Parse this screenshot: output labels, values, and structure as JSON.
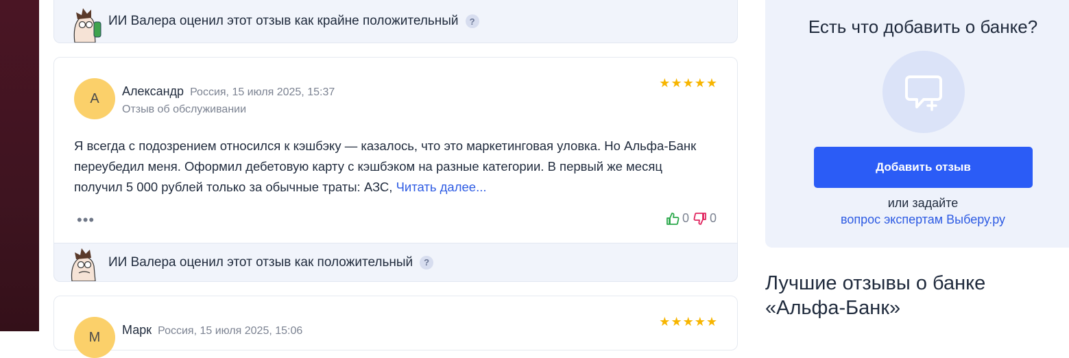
{
  "reviews": {
    "ai_bar_top": {
      "text": "ИИ Валера оценил этот отзыв как крайне положительный",
      "help": "?"
    },
    "review1": {
      "avatar_letter": "А",
      "author": "Александр",
      "meta": "Россия, 15 июля 2025, 15:37",
      "subtitle": "Отзыв об обслуживании",
      "rating": 5,
      "text": "Я всегда с подозрением относился к кэшбэку — казалось, что это маркетинговая уловка. Но Альфа-Банк переубедил меня. Оформил дебетовую карту с кэшбэком на разные категории. В первый же месяц получил 5 000 рублей только за обычные траты: АЗС,",
      "read_more": "Читать далее...",
      "more": "•••",
      "likes": "0",
      "dislikes": "0",
      "ai_text": "ИИ Валера оценил этот отзыв как положительный",
      "help": "?"
    },
    "review2": {
      "avatar_letter": "М",
      "author": "Марк",
      "meta": "Россия, 15 июля 2025, 15:06",
      "rating": 5
    }
  },
  "sidebar": {
    "title": "Есть что добавить о банке?",
    "add_button": "Добавить отзыв",
    "or_ask": "или задайте",
    "expert_link": "вопрос экспертам Выберу.ру",
    "best_title": "Лучшие отзывы о банке «Альфа-Банк»"
  },
  "colors": {
    "accent": "#2b5cf6",
    "link": "#2d5be3",
    "star": "#f7b500",
    "like": "#2aa84a",
    "dislike": "#e0245e",
    "ai_bar_bg": "#f1f4fb",
    "side_panel_bg": "#eef2fb",
    "avatar_bg": "#fbd06a"
  },
  "icons": [
    "ai-valera-avatar-icon",
    "help-icon",
    "star-icon",
    "thumb-up-icon",
    "thumb-down-icon",
    "chat-plus-icon"
  ]
}
